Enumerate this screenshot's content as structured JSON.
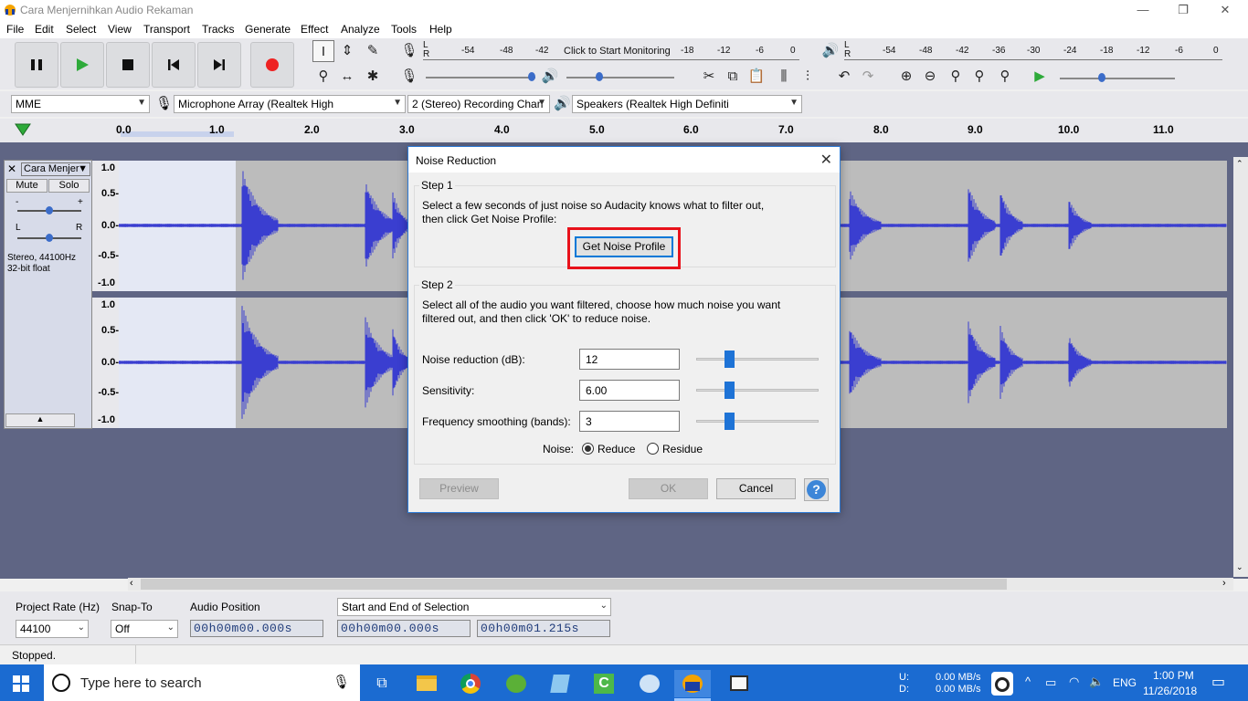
{
  "window": {
    "title": "Cara Menjernihkan Audio Rekaman"
  },
  "menu": [
    "File",
    "Edit",
    "Select",
    "View",
    "Transport",
    "Tracks",
    "Generate",
    "Effect",
    "Analyze",
    "Tools",
    "Help"
  ],
  "meters": {
    "record_scale": [
      "L",
      "R",
      "-54",
      "-48",
      "-42",
      "Click to Start Monitoring",
      "-18",
      "-12",
      "-6",
      "0"
    ],
    "play_scale": [
      "L",
      "R",
      "-54",
      "-48",
      "-42",
      "-36",
      "-30",
      "-24",
      "-18",
      "-12",
      "-6",
      "0"
    ]
  },
  "devices": {
    "host": "MME",
    "recording_device": "Microphone Array (Realtek High",
    "channels": "2 (Stereo) Recording Chan",
    "playback_device": "Speakers (Realtek High Definiti"
  },
  "ruler": [
    "0.0",
    "1.0",
    "2.0",
    "3.0",
    "4.0",
    "5.0",
    "6.0",
    "7.0",
    "8.0",
    "9.0",
    "10.0",
    "11.0"
  ],
  "track": {
    "name": "Cara Menjer",
    "mute": "Mute",
    "solo": "Solo",
    "gain_plus": "+",
    "gain_minus": "-",
    "pan_l": "L",
    "pan_r": "R",
    "info_rate": "Stereo, 44100Hz",
    "info_format": "32-bit float",
    "scale": [
      "1.0",
      "0.5-",
      "0.0-",
      "-0.5-",
      "-1.0"
    ]
  },
  "bottom": {
    "project_rate_label": "Project Rate (Hz)",
    "project_rate": "44100",
    "snap_label": "Snap-To",
    "snap_value": "Off",
    "audio_position_label": "Audio Position",
    "audio_position": "00h00m00.000s",
    "selection_mode": "Start and End of Selection",
    "sel_start": "00h00m00.000s",
    "sel_end": "00h00m01.215s"
  },
  "status": "Stopped.",
  "dialog": {
    "title": "Noise Reduction",
    "step1_label": "Step 1",
    "step1_text1": "Select a few seconds of just noise so Audacity knows what to filter out,",
    "step1_text2": "then click Get Noise Profile:",
    "get_profile": "Get Noise Profile",
    "step2_label": "Step 2",
    "step2_text1": "Select all of the audio you want filtered, choose how much noise you want",
    "step2_text2": "filtered out, and then click 'OK' to reduce noise.",
    "nr_label": "Noise reduction (dB):",
    "nr_value": "12",
    "sens_label": "Sensitivity:",
    "sens_value": "6.00",
    "freq_label": "Frequency smoothing (bands):",
    "freq_value": "3",
    "noise_label": "Noise:",
    "reduce": "Reduce",
    "residue": "Residue",
    "preview": "Preview",
    "ok": "OK",
    "cancel": "Cancel",
    "help": "?"
  },
  "taskbar": {
    "search_placeholder": "Type here to search",
    "net_up": "U:",
    "net_down": "D:",
    "up_rate": "0.00 MB/s",
    "down_rate": "0.00 MB/s",
    "lang": "ENG",
    "time": "1:00 PM",
    "date": "11/26/2018"
  }
}
